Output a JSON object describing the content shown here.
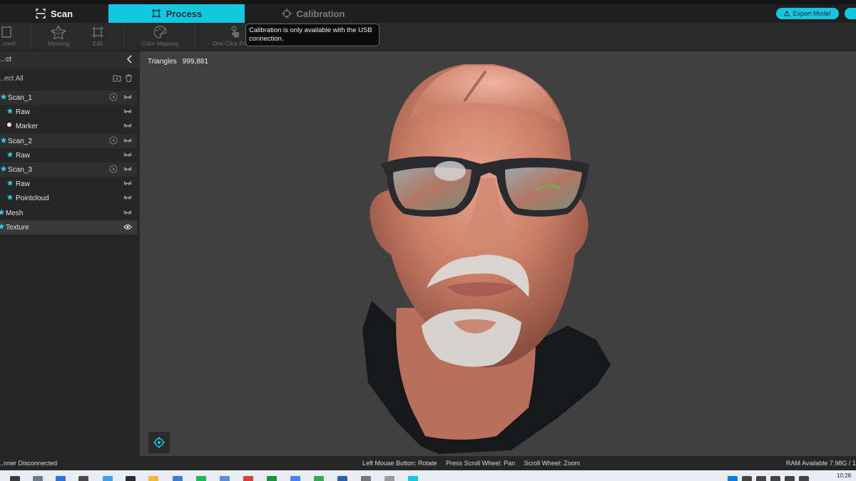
{
  "tabs": {
    "scan": "Scan",
    "process": "Process",
    "calibration": "Calibration"
  },
  "export_label": "Export Model",
  "toolbar": {
    "items": [
      {
        "label": "…ment",
        "icon": "align-icon"
      },
      {
        "label": "Meshing",
        "icon": "meshing-icon"
      },
      {
        "label": "Edit",
        "icon": "edit-icon"
      },
      {
        "label": "Color Mapping",
        "icon": "palette-icon"
      },
      {
        "label": "One-Click Proc…",
        "icon": "touch-icon"
      }
    ]
  },
  "tooltip": "Calibration is only available with the USB connection.",
  "panel": {
    "title": "…ct",
    "select_all": "…ect All",
    "tree": [
      {
        "label": "Scan_1",
        "kind": "scan",
        "icon": "scan-icon"
      },
      {
        "label": "Raw",
        "kind": "child",
        "icon": "raw-icon"
      },
      {
        "label": "Marker",
        "kind": "child",
        "icon": "marker-icon"
      },
      {
        "label": "Scan_2",
        "kind": "scan",
        "icon": "scan-icon"
      },
      {
        "label": "Raw",
        "kind": "child",
        "icon": "raw-icon"
      },
      {
        "label": "Scan_3",
        "kind": "scan",
        "icon": "scan-icon"
      },
      {
        "label": "Raw",
        "kind": "child",
        "icon": "raw-icon"
      },
      {
        "label": "Pointcloud",
        "kind": "child",
        "icon": "pointcloud-icon"
      },
      {
        "label": "Mesh",
        "kind": "top",
        "icon": "mesh-icon"
      },
      {
        "label": "Texture",
        "kind": "top-selected",
        "icon": "texture-icon"
      }
    ]
  },
  "viewport": {
    "triangles_label": "Triangles",
    "triangles_value": "999,881"
  },
  "status": {
    "left": "…nner Disconnected",
    "hints": [
      "Left Mouse Button: Rotate",
      "Press Scroll Wheel: Pan",
      "Scroll Wheel: Zoom"
    ],
    "ram": "RAM Available 7.98G / 15…"
  },
  "taskbar": {
    "clock": "10:28"
  },
  "colors": {
    "accent": "#14c7e0",
    "panel": "#262626",
    "viewport": "#404040"
  }
}
